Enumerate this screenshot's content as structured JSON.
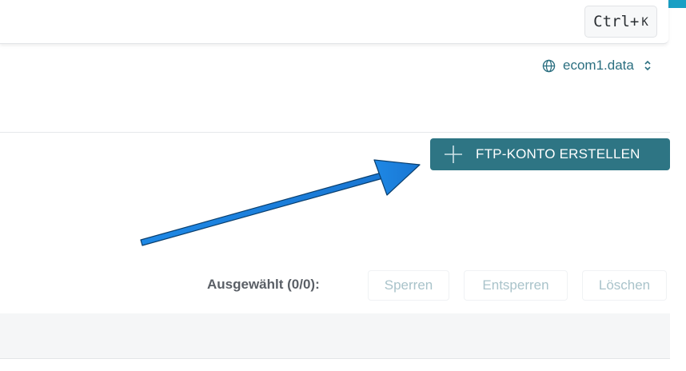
{
  "search": {
    "shortcut_main": "Ctrl+",
    "shortcut_key": "K"
  },
  "domain_selector": {
    "label": "ecom1.data",
    "icon": "globe-icon"
  },
  "create_button": {
    "label": "FTP-KONTO ERSTELLEN",
    "icon": "plus-icon"
  },
  "bulk_actions": {
    "label": "Ausgewählt (0/0):",
    "buttons": [
      "Sperren",
      "Entsperren",
      "Löschen"
    ]
  },
  "colors": {
    "accent": "#2e7584",
    "link": "#2b6f80",
    "disabled": "#a9c3ca",
    "annotation_arrow": "#1e88e5"
  }
}
